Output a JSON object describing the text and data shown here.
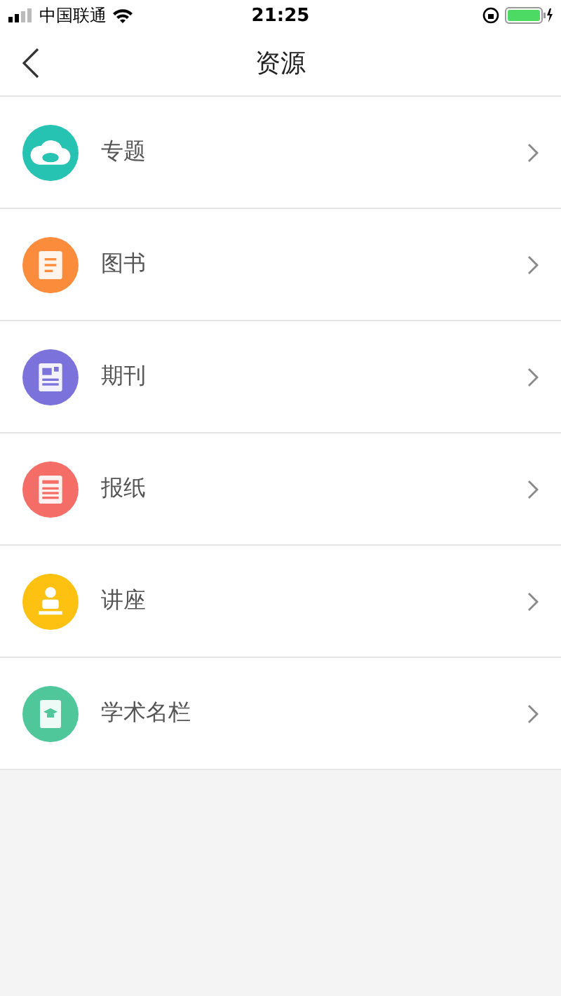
{
  "status_bar": {
    "carrier": "中国联通",
    "time": "21:25"
  },
  "nav": {
    "title": "资源"
  },
  "items": [
    {
      "label": "专题",
      "kind": "cloud",
      "color": "#26c3b3"
    },
    {
      "label": "图书",
      "kind": "book",
      "color": "#fb8c3c"
    },
    {
      "label": "期刊",
      "kind": "journal",
      "color": "#7b72dc"
    },
    {
      "label": "报纸",
      "kind": "newspaper",
      "color": "#f56d67"
    },
    {
      "label": "讲座",
      "kind": "lecture",
      "color": "#fdc112"
    },
    {
      "label": "学术名栏",
      "kind": "academic",
      "color": "#4fc79a"
    }
  ]
}
